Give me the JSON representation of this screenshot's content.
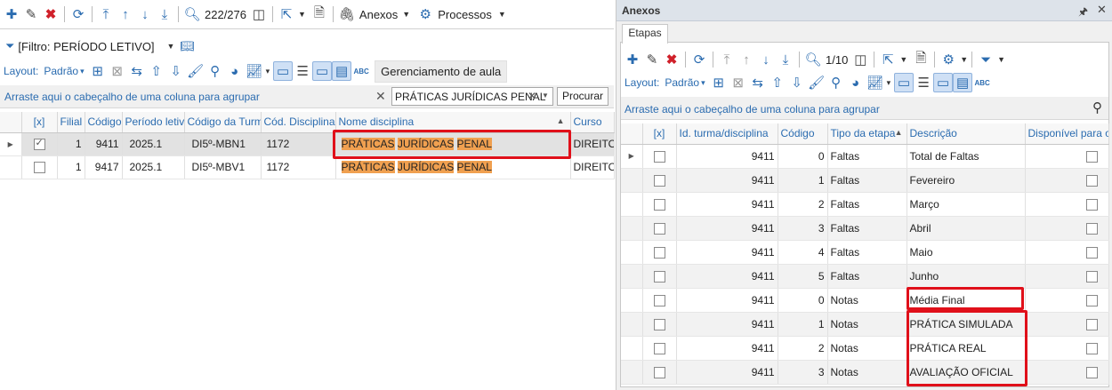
{
  "left": {
    "toolbar": {
      "page": "222/276",
      "anexos": "Anexos",
      "processos": "Processos"
    },
    "filter": {
      "label": "[Filtro: PERÍODO LETIVO]"
    },
    "layout": {
      "label": "Layout:",
      "value": "Padrão",
      "ger_tab": "Gerenciamento de aula"
    },
    "search": {
      "hint": "Arraste aqui o cabeçalho de uma coluna para agrupar",
      "value": "PRÁTICAS JURÍDICAS PENAL",
      "button": "Procurar"
    },
    "columns": [
      "[x]",
      "Filial",
      "Código",
      "Período letivo",
      "Código da Turma",
      "Cód. Disciplina",
      "Nome disciplina",
      "Curso"
    ],
    "rows": [
      {
        "checked": true,
        "filial": "1",
        "codigo": "9411",
        "periodo": "2025.1",
        "turma": "DI5º-MBN1",
        "cod_disc": "1172",
        "nome": [
          "PRÁTICAS",
          "JURÍDICAS",
          "PENAL"
        ],
        "curso": "DIREITO"
      },
      {
        "checked": false,
        "filial": "1",
        "codigo": "9417",
        "periodo": "2025.1",
        "turma": "DI5º-MBV1",
        "cod_disc": "1172",
        "nome": [
          "PRÁTICAS",
          "JURÍDICAS",
          "PENAL"
        ],
        "curso": "DIREITO"
      }
    ]
  },
  "right": {
    "title": "Anexos",
    "tab": "Etapas",
    "toolbar": {
      "page": "1/10"
    },
    "layout": {
      "label": "Layout:",
      "value": "Padrão"
    },
    "group_hint": "Arraste aqui o cabeçalho de uma coluna para agrupar",
    "columns": [
      "[x]",
      "Id. turma/disciplina",
      "Código",
      "Tipo da etapa",
      "Descrição",
      "Disponível para os"
    ],
    "rows": [
      {
        "id": "9411",
        "codigo": "0",
        "tipo": "Faltas",
        "desc": "Total de Faltas"
      },
      {
        "id": "9411",
        "codigo": "1",
        "tipo": "Faltas",
        "desc": "Fevereiro"
      },
      {
        "id": "9411",
        "codigo": "2",
        "tipo": "Faltas",
        "desc": "Março"
      },
      {
        "id": "9411",
        "codigo": "3",
        "tipo": "Faltas",
        "desc": "Abril"
      },
      {
        "id": "9411",
        "codigo": "4",
        "tipo": "Faltas",
        "desc": "Maio"
      },
      {
        "id": "9411",
        "codigo": "5",
        "tipo": "Faltas",
        "desc": "Junho"
      },
      {
        "id": "9411",
        "codigo": "0",
        "tipo": "Notas",
        "desc": "Média Final"
      },
      {
        "id": "9411",
        "codigo": "1",
        "tipo": "Notas",
        "desc": "PRÁTICA SIMULADA"
      },
      {
        "id": "9411",
        "codigo": "2",
        "tipo": "Notas",
        "desc": "PRÁTICA REAL"
      },
      {
        "id": "9411",
        "codigo": "3",
        "tipo": "Notas",
        "desc": "AVALIAÇÃO OFICIAL"
      }
    ]
  }
}
